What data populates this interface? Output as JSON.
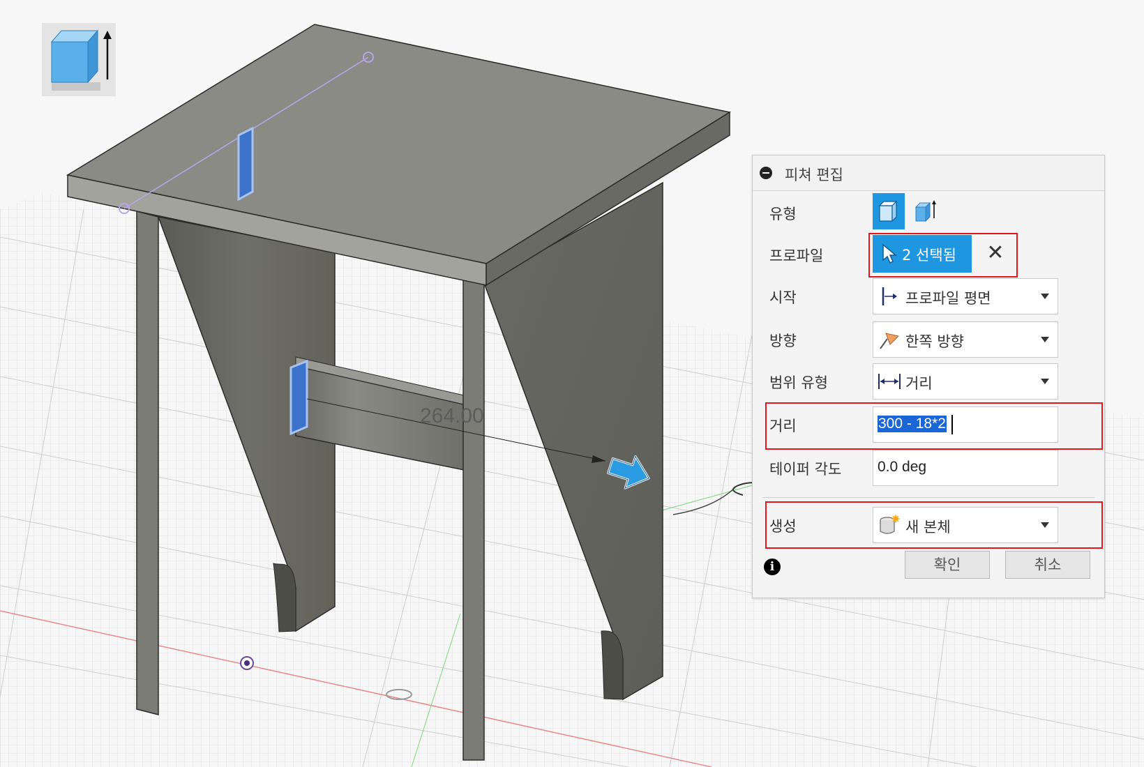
{
  "viewport": {
    "dimension_value": "264.00"
  },
  "panel": {
    "title": "피쳐 편집",
    "rows": {
      "type": {
        "label": "유형"
      },
      "profile": {
        "label": "프로파일",
        "selection_text": "2 선택됨"
      },
      "start": {
        "label": "시작",
        "value": "프로파일 평면"
      },
      "direction": {
        "label": "방향",
        "value": "한쪽 방향"
      },
      "extent_type": {
        "label": "범위 유형",
        "value": "거리"
      },
      "distance": {
        "label": "거리",
        "value": "300 - 18*2"
      },
      "taper_angle": {
        "label": "테이퍼 각도",
        "value": "0.0 deg"
      },
      "operation": {
        "label": "생성",
        "value": "새 본체"
      }
    },
    "buttons": {
      "ok": "확인",
      "cancel": "취소"
    }
  },
  "colors": {
    "accent": "#1f96e0",
    "highlight_box": "#e3161d",
    "selection": "#1a66d6"
  }
}
